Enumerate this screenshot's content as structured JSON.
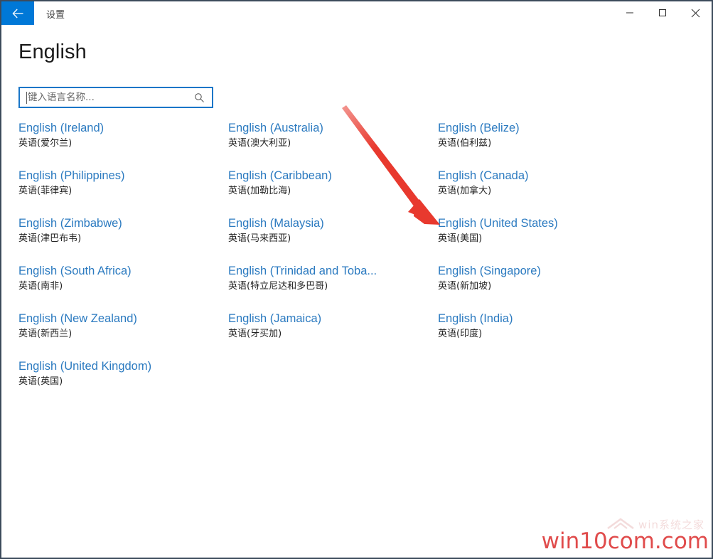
{
  "window": {
    "titlebar": {
      "app_title": "设置",
      "back_icon": "back-arrow-icon",
      "minimize_label": "—",
      "maximize_label": "□",
      "close_label": "✕"
    },
    "accent_color": "#0078d7",
    "border_color": "#3d4b5c"
  },
  "page": {
    "title": "English",
    "link_color": "#2b7ac0"
  },
  "search": {
    "value": "",
    "placeholder": "键入语言名称...",
    "icon": "search-icon",
    "border_color": "#1976c8"
  },
  "languages": {
    "columns": [
      {
        "items": [
          {
            "name": "English (Ireland)",
            "native": "英语(爱尔兰)"
          },
          {
            "name": "English (Philippines)",
            "native": "英语(菲律宾)"
          },
          {
            "name": "English (Zimbabwe)",
            "native": "英语(津巴布韦)"
          },
          {
            "name": "English (South Africa)",
            "native": "英语(南非)"
          },
          {
            "name": "English (New Zealand)",
            "native": "英语(新西兰)"
          },
          {
            "name": "English (United Kingdom)",
            "native": "英语(英国)"
          }
        ]
      },
      {
        "items": [
          {
            "name": "English (Australia)",
            "native": "英语(澳大利亚)"
          },
          {
            "name": "English (Caribbean)",
            "native": "英语(加勒比海)"
          },
          {
            "name": "English (Malaysia)",
            "native": "英语(马来西亚)"
          },
          {
            "name": "English (Trinidad and Toba...",
            "native": "英语(特立尼达和多巴哥)"
          },
          {
            "name": "English (Jamaica)",
            "native": "英语(牙买加)"
          }
        ]
      },
      {
        "items": [
          {
            "name": "English (Belize)",
            "native": "英语(伯利兹)"
          },
          {
            "name": "English (Canada)",
            "native": "英语(加拿大)"
          },
          {
            "name": "English (United States)",
            "native": "英语(美国)"
          },
          {
            "name": "English (Singapore)",
            "native": "英语(新加坡)"
          },
          {
            "name": "English (India)",
            "native": "英语(印度)"
          }
        ]
      }
    ]
  },
  "annotation": {
    "arrow_color": "#e8392e",
    "target": "English (United States)"
  },
  "watermark": {
    "text": "win10com.com",
    "logo_text": "win系统之家",
    "color": "#e04b4b"
  }
}
